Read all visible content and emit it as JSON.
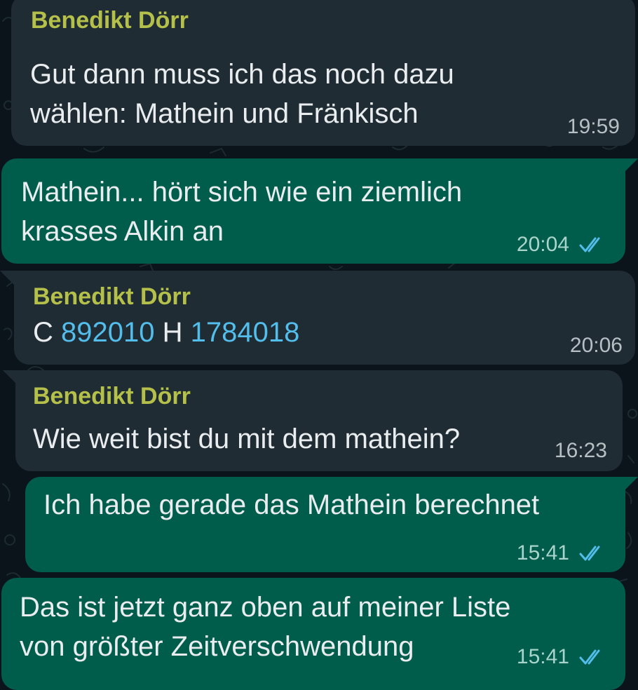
{
  "conversation": {
    "messages": [
      {
        "direction": "incoming",
        "sender": "Benedikt Dörr",
        "lines": [
          "Gut dann muss ich das noch dazu",
          "wählen: Mathein und Fränkisch"
        ],
        "time": "19:59"
      },
      {
        "direction": "outgoing",
        "lines": [
          "Mathein... hört sich wie ein ziemlich",
          "krasses Alkin an"
        ],
        "time": "20:04",
        "status": "read"
      },
      {
        "direction": "incoming",
        "sender": "Benedikt Dörr",
        "parts": [
          {
            "text": "C ",
            "type": "text"
          },
          {
            "text": "892010",
            "type": "phone"
          },
          {
            "text": " H ",
            "type": "text"
          },
          {
            "text": "1784018",
            "type": "phone"
          }
        ],
        "time": "20:06"
      },
      {
        "direction": "incoming",
        "sender": "Benedikt Dörr",
        "lines": [
          "Wie weit bist du mit dem mathein?"
        ],
        "time": "16:23"
      },
      {
        "direction": "outgoing",
        "lines": [
          "Ich habe gerade das Mathein berechnet"
        ],
        "time": "15:41",
        "status": "read"
      },
      {
        "direction": "outgoing",
        "lines": [
          "Das ist jetzt ganz oben auf meiner Liste",
          "von größter Zeitverschwendung"
        ],
        "time": "15:41",
        "status": "read"
      }
    ]
  },
  "colors": {
    "background": "#0b141a",
    "incoming_bubble": "#202c33",
    "outgoing_bubble": "#005c4b",
    "sender_name": "#b4c04a",
    "link": "#53bdeb",
    "read_ticks": "#53bdeb"
  },
  "icons": {
    "read_receipt": "double-check-icon"
  }
}
